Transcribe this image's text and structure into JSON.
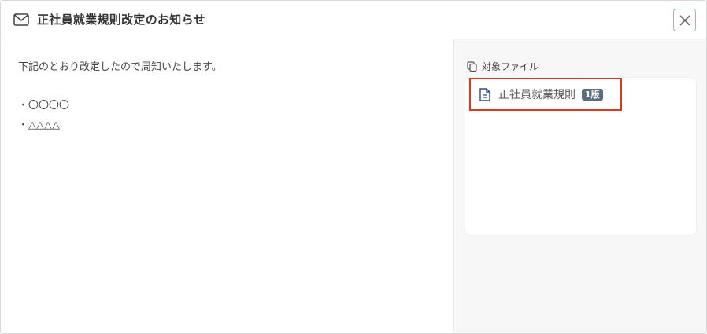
{
  "header": {
    "title": "正社員就業規則改定のお知らせ",
    "mail_icon": "mail-icon",
    "close_icon": "close-icon"
  },
  "message": {
    "body": "下記のとおり改定したので周知いたします。",
    "bullets": [
      "・〇〇〇〇",
      "・△△△△"
    ]
  },
  "files": {
    "label": "対象ファイル",
    "label_icon": "copy-icon",
    "items": [
      {
        "name": "正社員就業規則",
        "version": "1版",
        "icon": "document-icon"
      }
    ]
  },
  "colors": {
    "highlight_border": "#e03a1e",
    "close_border": "#7cc4d1",
    "badge_bg": "#5d6b7f",
    "doc_icon": "#2f4a8a"
  }
}
